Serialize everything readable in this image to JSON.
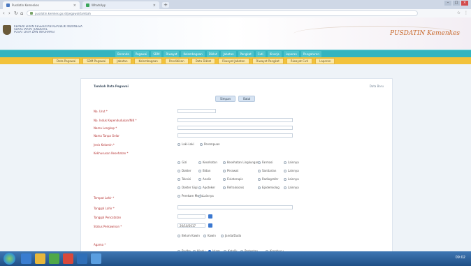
{
  "browser": {
    "tabs": [
      {
        "label": "Pusdatin Kemenkes"
      },
      {
        "label": "WhatsApp"
      }
    ],
    "new_tab": "+",
    "window_controls": [
      "–",
      "□",
      "×"
    ],
    "url": "pusdatin.kemkes.go.id/pegawai/tambah",
    "nav": {
      "back": "‹",
      "forward": "›",
      "reload": "↻",
      "home": "⌂"
    }
  },
  "site": {
    "title_lines": [
      "KEMENTERIAN KESEHATAN REPUBLIK INDONESIA",
      "SEKRETARIAT JENDERAL",
      "PUSAT DATA DAN INFORMASI"
    ],
    "tagline": "PUSDATIN Kemenkes"
  },
  "menu": [
    "Beranda",
    "Pegawai",
    "SDM",
    "Riwayat",
    "Kelembagaan",
    "Diklat",
    "Jabatan",
    "Pangkat",
    "Cuti",
    "Kinerja",
    "Laporan",
    "Pengaturan"
  ],
  "submenu": [
    "Data Pegawai",
    "SDM Pegawai",
    "Jabatan",
    "Kelembagaan",
    "Pendidikan",
    "Data Diklat",
    "Riwayat Jabatan",
    "Riwayat Pangkat",
    "Riwayat Cuti",
    "Laporan"
  ],
  "form": {
    "title": "Tambah Data Pegawai",
    "data_total": "Data Baru",
    "buttons": {
      "save": "Simpan",
      "reset": "Batal"
    },
    "labels": {
      "nip": "No. Urut *",
      "nik": "No. Induk Kependudukan/NIK *",
      "nama": "Nama Lengkap *",
      "nama_tanpa_gelar": "Nama Tanpa Gelar",
      "jenis_kelamin": "Jenis Kelamin *",
      "kekhususan": "Kekhususan Kesehatan *",
      "tempat_lahir": "Tempat Lahir *",
      "tanggal_lahir": "Tanggal Lahir *",
      "tanggal_pencatatan": "Tanggal Pencatatan",
      "status_perkawinan": "Status Perkawinan *",
      "agama": "Agama *"
    },
    "gender_options": [
      "Laki-Laki",
      "Perempuan"
    ],
    "kekhususan_options": [
      [
        "Gizi",
        "Kesehatan",
        "Kesehatan Lingkungan",
        "Farmasi",
        "Lainnya"
      ],
      [
        "Dokter",
        "Bidan",
        "Perawat",
        "Sanitarian",
        "Lainnya"
      ],
      [
        "Teknisi",
        "Analis",
        "Fisioterapis",
        "Radiografer",
        "Lainnya"
      ],
      [
        "Dokter Gigi",
        "Apoteker",
        "Refraksionis",
        "Epidemiolog",
        "Lainnya"
      ],
      [
        "Perekam Medis",
        "Lainnya"
      ]
    ],
    "tanggal_pencatatan_value": "26/10/2017",
    "status_options": [
      "Belum Kawin",
      "Kawin",
      "Janda/Duda"
    ],
    "agama_options": [
      "Budha",
      "Hindu",
      "Islam",
      "Katolik",
      "Protestan",
      "Konghucu"
    ],
    "agama_selected": "Islam"
  },
  "taskbar": {
    "clock": "09:02"
  }
}
